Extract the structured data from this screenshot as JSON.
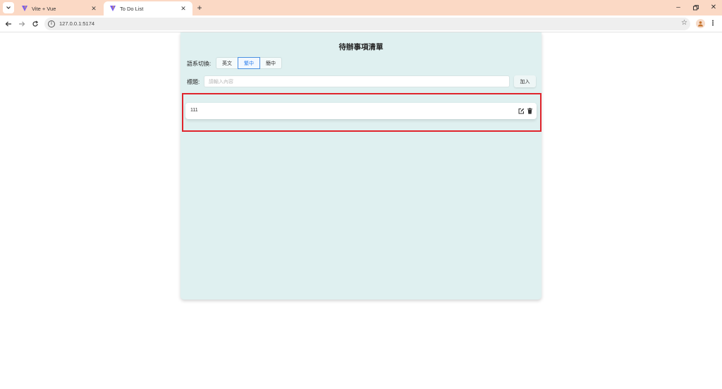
{
  "browser": {
    "tabs": [
      {
        "title": "Vite + Vue",
        "active": false
      },
      {
        "title": "To Do List",
        "active": true
      }
    ],
    "url": "127.0.0.1:5174"
  },
  "page": {
    "title": "待辦事項清單",
    "language_label": "語系切換:",
    "language_options": [
      {
        "label": "英文",
        "selected": false
      },
      {
        "label": "繁中",
        "selected": true
      },
      {
        "label": "簡中",
        "selected": false
      }
    ],
    "title_label": "標題:",
    "input_placeholder": "請輸入內容",
    "input_value": "",
    "add_button": "加入",
    "todos": [
      {
        "text": "111"
      }
    ]
  },
  "colors": {
    "tab_bar": "#fbd9c5",
    "card_background": "#dff0f0",
    "selected_language": "#2f80ed",
    "highlight_border": "#e0242c"
  },
  "icons": [
    "tab-search-icon",
    "vite-favicon-icon",
    "close-icon",
    "plus-icon",
    "minimize-icon",
    "restore-icon",
    "back-icon",
    "forward-icon",
    "reload-icon",
    "site-info-icon",
    "bookmark-star-icon",
    "profile-icon",
    "menu-kebab-icon",
    "edit-icon",
    "trash-icon"
  ]
}
